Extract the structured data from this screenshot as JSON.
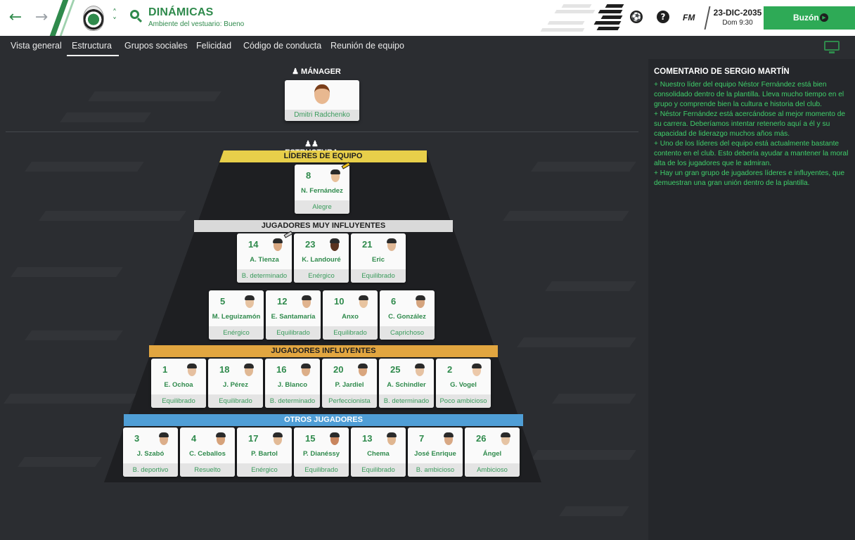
{
  "header": {
    "title": "DINÁMICAS",
    "subtitle": "Ambiente del vestuario: Bueno",
    "fm_label": "FM",
    "date": "23-DIC-2035",
    "time": "Dom 9:30",
    "inbox_label": "Buzón",
    "icons": [
      "back-arrow-icon",
      "forward-arrow-icon",
      "club-crest-icon",
      "chevron-up-down-icon",
      "search-icon",
      "football-icon",
      "help-icon",
      "monitor-icon"
    ]
  },
  "tabs": [
    {
      "label": "Vista general"
    },
    {
      "label": "Estructura",
      "active": true
    },
    {
      "label": "Grupos sociales"
    },
    {
      "label": "Felicidad"
    },
    {
      "label": "Código de conducta"
    },
    {
      "label": "Reunión de equipo"
    }
  ],
  "manager": {
    "heading": "MÁNAGER",
    "name": "Dmitri Radchenko"
  },
  "structure": {
    "heading": "ESTRUCTURA",
    "tiers": [
      {
        "label": "LÍDERES DE EQUIPO",
        "color": "#e8cf4a"
      },
      {
        "label": "JUGADORES MUY INFLUYENTES",
        "color": "#d9d9d9"
      },
      {
        "label": "JUGADORES INFLUYENTES",
        "color": "#e2a640"
      },
      {
        "label": "OTROS JUGADORES",
        "color": "#4f9ed6"
      }
    ],
    "leaders": [
      {
        "number": "8",
        "name": "N. Fernández",
        "mood": "Alegre",
        "skin": "#e8c09a",
        "captain": true
      }
    ],
    "very_influential_row1": [
      {
        "number": "14",
        "name": "A. Tienza",
        "mood": "B. determinado",
        "skin": "#d9a882",
        "captain": true
      },
      {
        "number": "23",
        "name": "K. Landouré",
        "mood": "Enérgico",
        "skin": "#5a3320"
      },
      {
        "number": "21",
        "name": "Eric",
        "mood": "Equilibrado",
        "skin": "#e0b896"
      }
    ],
    "very_influential_row2": [
      {
        "number": "5",
        "name": "M. Leguizamón",
        "mood": "Enérgico",
        "skin": "#e6c2a0"
      },
      {
        "number": "12",
        "name": "E. Santamaría",
        "mood": "Equilibrado",
        "skin": "#e0b38e"
      },
      {
        "number": "10",
        "name": "Anxo",
        "mood": "Equilibrado",
        "skin": "#e8c4a0"
      },
      {
        "number": "6",
        "name": "C. González",
        "mood": "Caprichoso",
        "skin": "#d5a47e"
      }
    ],
    "influential": [
      {
        "number": "1",
        "name": "E. Ochoa",
        "mood": "Equilibrado",
        "skin": "#e6c0a0"
      },
      {
        "number": "18",
        "name": "J. Pérez",
        "mood": "Equilibrado",
        "skin": "#e0b894"
      },
      {
        "number": "16",
        "name": "J. Blanco",
        "mood": "B. determinado",
        "skin": "#dcae88"
      },
      {
        "number": "20",
        "name": "P. Jardiel",
        "mood": "Perfeccionista",
        "skin": "#d9a67e"
      },
      {
        "number": "25",
        "name": "A. Schindler",
        "mood": "B. determinado",
        "skin": "#e6c2a2"
      },
      {
        "number": "2",
        "name": "G. Vogel",
        "mood": "Poco ambicioso",
        "skin": "#ecc9aa"
      }
    ],
    "others": [
      {
        "number": "3",
        "name": "J. Szabó",
        "mood": "B. deportivo",
        "skin": "#dcae8a"
      },
      {
        "number": "4",
        "name": "C. Ceballos",
        "mood": "Resuelto",
        "skin": "#d6a27a"
      },
      {
        "number": "17",
        "name": "P. Bartol",
        "mood": "Enérgico",
        "skin": "#e2ba96"
      },
      {
        "number": "15",
        "name": "P. Dianéssy",
        "mood": "Equilibrado",
        "skin": "#c9855e"
      },
      {
        "number": "13",
        "name": "Chema",
        "mood": "Equilibrado",
        "skin": "#e0b690"
      },
      {
        "number": "7",
        "name": "José Enrique",
        "mood": "B. ambicioso",
        "skin": "#d8a884"
      },
      {
        "number": "26",
        "name": "Ángel",
        "mood": "Ambicioso",
        "skin": "#e6c4a4"
      }
    ]
  },
  "comment": {
    "title": "COMENTARIO DE SERGIO MARTÍN",
    "lines": [
      "+    Nuestro líder del equipo Néstor Fernández está bien consolidado dentro de la plantilla. Lleva mucho tiempo en el grupo y comprende bien la cultura e historia del club.",
      "+    Néstor Fernández está acercándose al mejor momento de su carrera. Deberíamos intentar retenerlo aquí a él y su capacidad de liderazgo muchos años más.",
      "+    Uno de los líderes del equipo está actualmente bastante contento en el club. Esto debería ayudar a mantener la moral alta de los jugadores que le admiran.",
      "+    Hay un gran grupo de jugadores líderes e influyentes, que demuestran una gran unión dentro de la plantilla."
    ]
  }
}
